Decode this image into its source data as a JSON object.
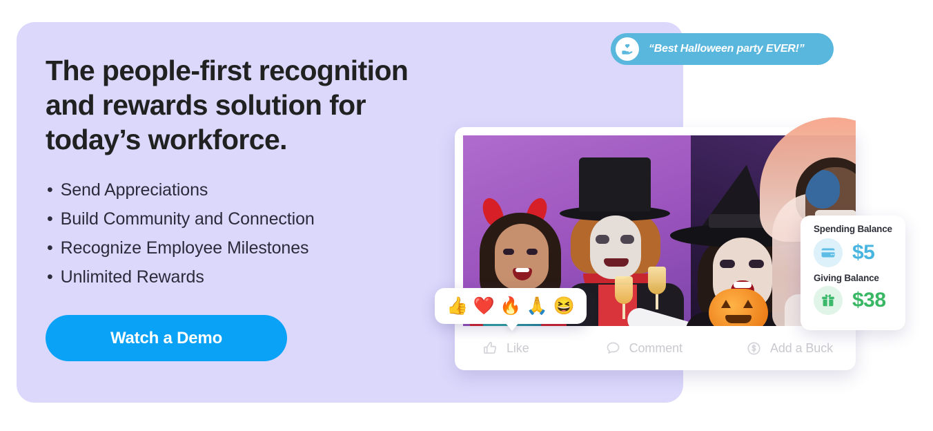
{
  "hero": {
    "headline": "The people-first recognition and rewards solution for today’s workforce.",
    "bullets": [
      "Send Appreciations",
      "Build Community and Connection",
      "Recognize Employee Milestones",
      "Unlimited Rewards"
    ],
    "cta_label": "Watch a Demo",
    "panel_color": "#dbd8fc",
    "cta_color": "#0aa2f7",
    "headline_color": "#212121"
  },
  "quote": {
    "text": "“Best Halloween party EVER!”",
    "bubble_color": "#59b7dd",
    "avatar_icon": "hand-holding-heart-icon"
  },
  "post": {
    "photo_alt": "Group of four people in Halloween costumes celebrating with champagne and a jack-o-lantern",
    "reactions": [
      {
        "name": "thumbs-up-reaction",
        "glyph": "👍"
      },
      {
        "name": "heart-reaction",
        "glyph": "❤️"
      },
      {
        "name": "fire-reaction",
        "glyph": "🔥"
      },
      {
        "name": "pray-reaction",
        "glyph": "🙏"
      },
      {
        "name": "laughing-reaction",
        "glyph": "😆"
      }
    ],
    "actions": [
      {
        "name": "like-action",
        "label": "Like",
        "icon": "thumbs-up-icon"
      },
      {
        "name": "comment-action",
        "label": "Comment",
        "icon": "speech-bubble-icon"
      },
      {
        "name": "add-a-buck-action",
        "label": "Add a Buck",
        "icon": "dollar-circle-icon"
      }
    ],
    "action_text_color": "#c9c9cf"
  },
  "balances": {
    "spending": {
      "label": "Spending Balance",
      "amount": "$5",
      "icon": "credit-card-icon",
      "color": "#48b4e0"
    },
    "giving": {
      "label": "Giving Balance",
      "amount": "$38",
      "icon": "gift-icon",
      "color": "#39b765"
    }
  }
}
